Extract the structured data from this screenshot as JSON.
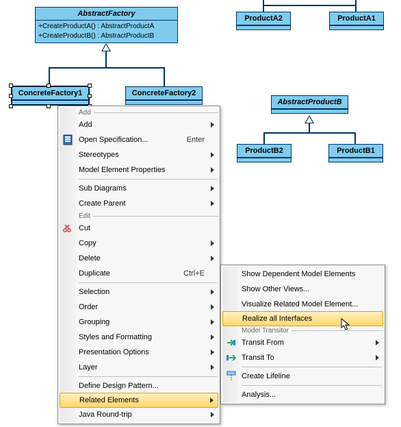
{
  "classes": {
    "abstractFactory": {
      "name": "AbstractFactory",
      "methods": [
        "+CreateProductA() : AbstractProductA",
        "+CreateProductB() : AbstractProductB"
      ]
    },
    "concreteFactory1": {
      "name": "ConcreteFactory1"
    },
    "concreteFactory2": {
      "name": "ConcreteFactory2"
    },
    "productA2": {
      "name": "ProductA2"
    },
    "productA1": {
      "name": "ProductA1"
    },
    "abstractProductB": {
      "name": "AbstractProductB"
    },
    "productB2": {
      "name": "ProductB2"
    },
    "productB1": {
      "name": "ProductB1"
    }
  },
  "menu": {
    "group_add": "Add",
    "items": {
      "add": "Add",
      "openSpec": "Open Specification...",
      "openSpec_sc": "Enter",
      "stereotypes": "Stereotypes",
      "modelElemProps": "Model Element Properties",
      "subDiagrams": "Sub Diagrams",
      "createParent": "Create Parent",
      "edit_group": "Edit",
      "cut": "Cut",
      "copy": "Copy",
      "delete": "Delete",
      "duplicate": "Duplicate",
      "duplicate_sc": "Ctrl+E",
      "selection": "Selection",
      "order": "Order",
      "grouping": "Grouping",
      "stylesFormatting": "Styles and Formatting",
      "presentationOptions": "Presentation Options",
      "layer": "Layer",
      "defineDesignPattern": "Define Design Pattern...",
      "relatedElements": "Related Elements",
      "javaRoundTrip": "Java Round-trip"
    }
  },
  "submenu": {
    "showDependent": "Show Dependent Model Elements",
    "showOtherViews": "Show Other Views...",
    "visualizeRelated": "Visualize Related Model Element...",
    "realizeInterfaces": "Realize all Interfaces",
    "modelTransitor_group": "Model Transitor",
    "transitFrom": "Transit From",
    "transitTo": "Transit To",
    "createLifeline": "Create Lifeline",
    "analysis": "Analysis..."
  }
}
